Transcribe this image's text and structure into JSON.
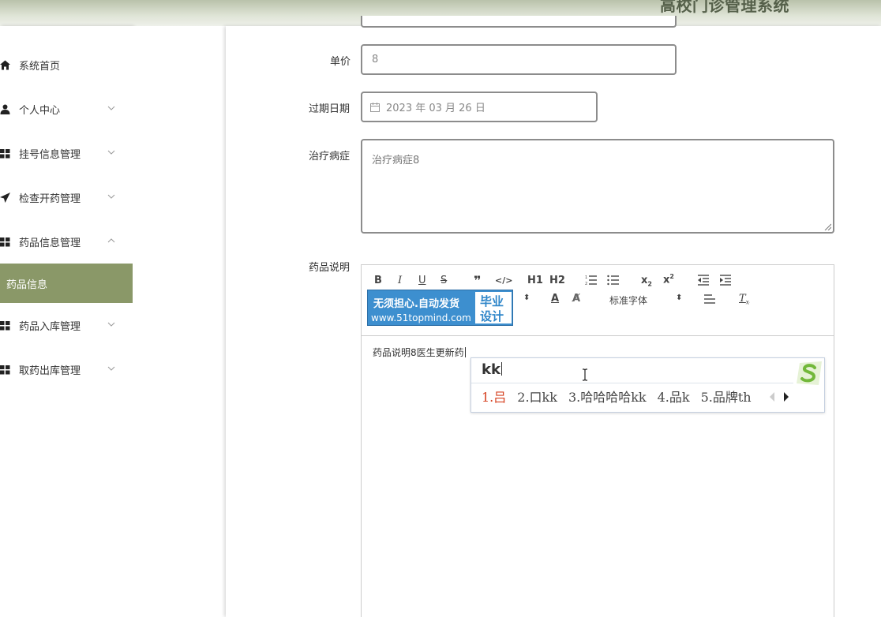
{
  "header": {
    "title": "高校门诊管理系统"
  },
  "sidebar": {
    "items": [
      {
        "label": "系统首页",
        "icon": "home-icon",
        "has_arrow": false
      },
      {
        "label": "个人中心",
        "icon": "user-icon",
        "has_arrow": true
      },
      {
        "label": "挂号信息管理",
        "icon": "grid-icon",
        "has_arrow": true
      },
      {
        "label": "检查开药管理",
        "icon": "send-icon",
        "has_arrow": true
      },
      {
        "label": "药品信息管理",
        "icon": "grid-icon",
        "has_arrow": true,
        "expanded": true
      },
      {
        "label": "药品入库管理",
        "icon": "grid-icon",
        "has_arrow": true
      },
      {
        "label": "取药出库管理",
        "icon": "grid-icon",
        "has_arrow": true
      }
    ],
    "active_subitem": "药品信息",
    "active_color": "#8a9868"
  },
  "form": {
    "price": {
      "label": "单价",
      "value": "8"
    },
    "expiry": {
      "label": "过期日期",
      "value": "2023 年 03 月 26 日",
      "icon": "calendar-icon"
    },
    "treatment": {
      "label": "治疗病症",
      "value": "治疗病症8"
    },
    "description": {
      "label": "药品说明",
      "content": "药品说明8医生更新药",
      "toolbar": {
        "font_family": "标准字体",
        "h1": "H1",
        "h2": "H2"
      }
    }
  },
  "watermark": {
    "main": "无须担心.自动发货",
    "url": "www.51topmind.com",
    "right_line1": "毕业",
    "right_line2": "设计"
  },
  "ime": {
    "input": "kk",
    "candidates": [
      "1.吕",
      "2.口kk",
      "3.哈哈哈哈kk",
      "4.品k",
      "5.品牌th"
    ],
    "logo": "sogou-logo"
  }
}
